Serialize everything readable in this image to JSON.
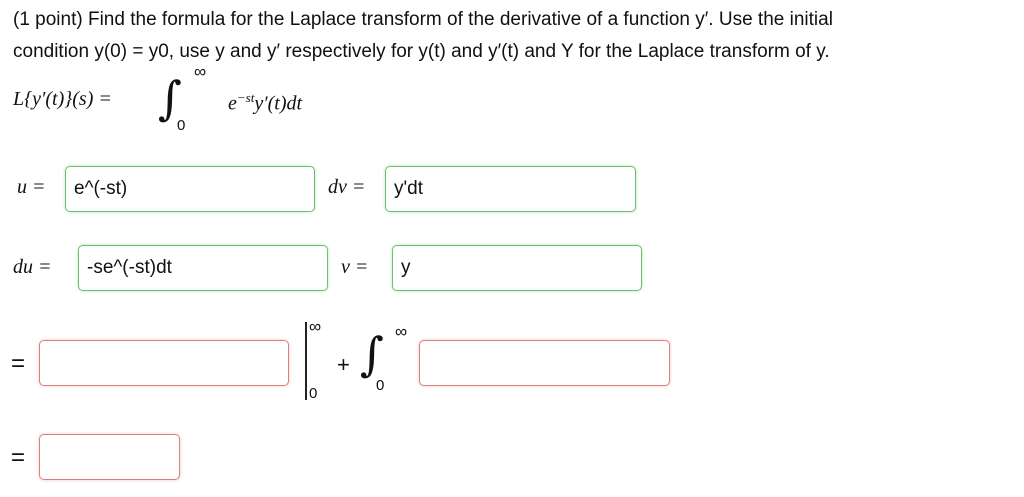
{
  "problem": {
    "line1": "(1 point) Find the formula for the Laplace transform of the derivative of a function y′. Use the initial",
    "line2": "condition y(0) = y0, use y and y′ respectively for y(t) and y′(t) and Y for the Laplace transform of y."
  },
  "definition": {
    "lhs": "L{y′(t)}(s) =",
    "upper": "∞",
    "lower": "0",
    "integrand_base": "e",
    "integrand_exp": "−st",
    "integrand_rest": "y′(t)dt"
  },
  "by_parts": {
    "u_label": "u =",
    "u_value": "e^(-st)",
    "dv_label": "dv =",
    "dv_value": "y'dt",
    "du_label": "du =",
    "du_value": "-se^(-st)dt",
    "v_label": "v =",
    "v_value": "y"
  },
  "step1": {
    "equals": "=",
    "first_value": "",
    "eval_upper": "∞",
    "eval_lower": "0",
    "plus": "+",
    "int_upper": "∞",
    "int_lower": "0",
    "second_value": ""
  },
  "step2": {
    "equals": "=",
    "value": ""
  },
  "colors": {
    "correct_border": "#6cbf6c",
    "incorrect_border": "#d98080"
  }
}
